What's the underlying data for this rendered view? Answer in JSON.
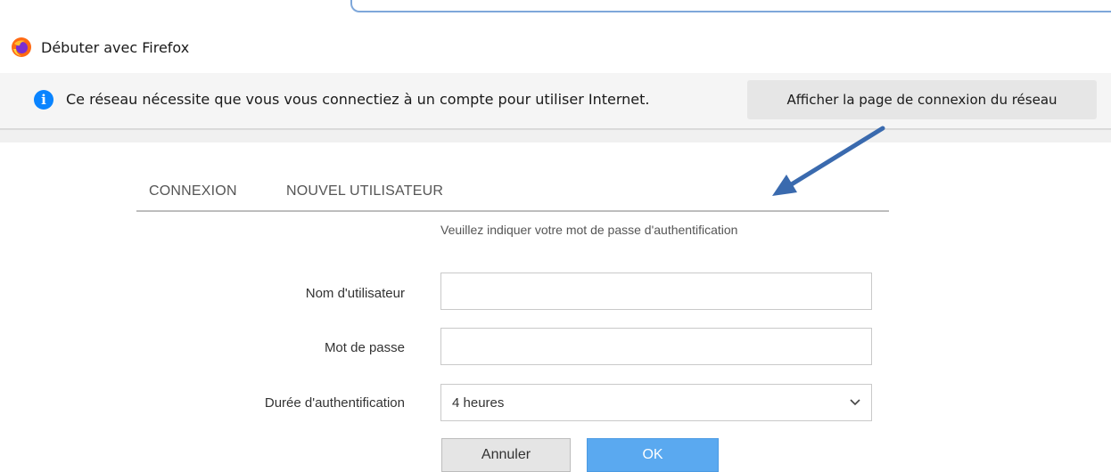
{
  "bookmarks": {
    "item_label": "Débuter avec Firefox"
  },
  "notification": {
    "message": "Ce réseau nécessite que vous vous connectiez à un compte pour utiliser Internet.",
    "button_label": "Afficher la page de connexion du réseau"
  },
  "tabs": {
    "login": "CONNEXION",
    "new_user": "NOUVEL UTILISATEUR"
  },
  "form": {
    "hint": "Veuillez indiquer votre mot de passe d'authentification",
    "username_label": "Nom d'utilisateur",
    "username_value": "",
    "password_label": "Mot de passe",
    "password_value": "",
    "duration_label": "Durée d'authentification",
    "duration_value": "4 heures",
    "cancel_label": "Annuler",
    "ok_label": "OK"
  },
  "colors": {
    "info": "#0a84ff",
    "ok_button": "#5aa9f0",
    "arrow": "#3a6aae"
  }
}
